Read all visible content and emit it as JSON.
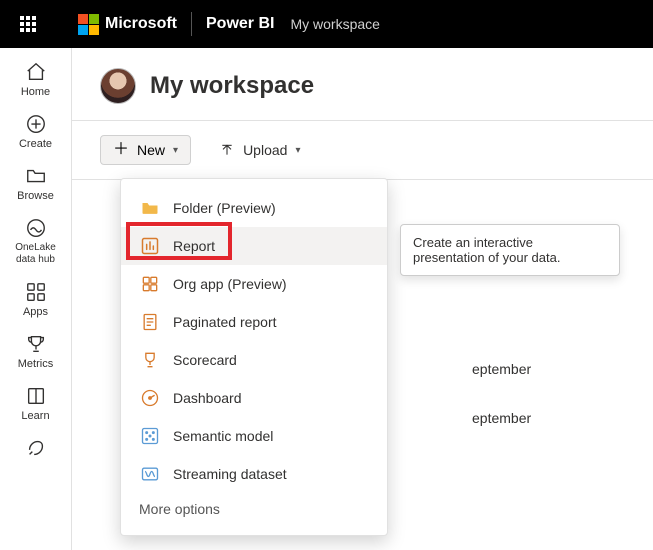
{
  "topbar": {
    "brand": "Microsoft",
    "product": "Power BI",
    "breadcrumb": "My workspace"
  },
  "rail": {
    "items": [
      {
        "label": "Home"
      },
      {
        "label": "Create"
      },
      {
        "label": "Browse"
      },
      {
        "label": "OneLake data hub"
      },
      {
        "label": "Apps"
      },
      {
        "label": "Metrics"
      },
      {
        "label": "Learn"
      }
    ]
  },
  "workspace": {
    "title": "My workspace"
  },
  "toolbar": {
    "new_label": "New",
    "upload_label": "Upload"
  },
  "new_menu": {
    "items": [
      {
        "label": "Folder (Preview)"
      },
      {
        "label": "Report"
      },
      {
        "label": "Org app (Preview)"
      },
      {
        "label": "Paginated report"
      },
      {
        "label": "Scorecard"
      },
      {
        "label": "Dashboard"
      },
      {
        "label": "Semantic model"
      },
      {
        "label": "Streaming dataset"
      }
    ],
    "more_label": "More options"
  },
  "tooltip": {
    "report": "Create an interactive presentation of your data."
  },
  "content_rows": {
    "r1_partial": "eptember",
    "r2_partial": "eptember"
  },
  "colors": {
    "highlight": "#e3262d",
    "accent_orange": "#d87b2d"
  }
}
